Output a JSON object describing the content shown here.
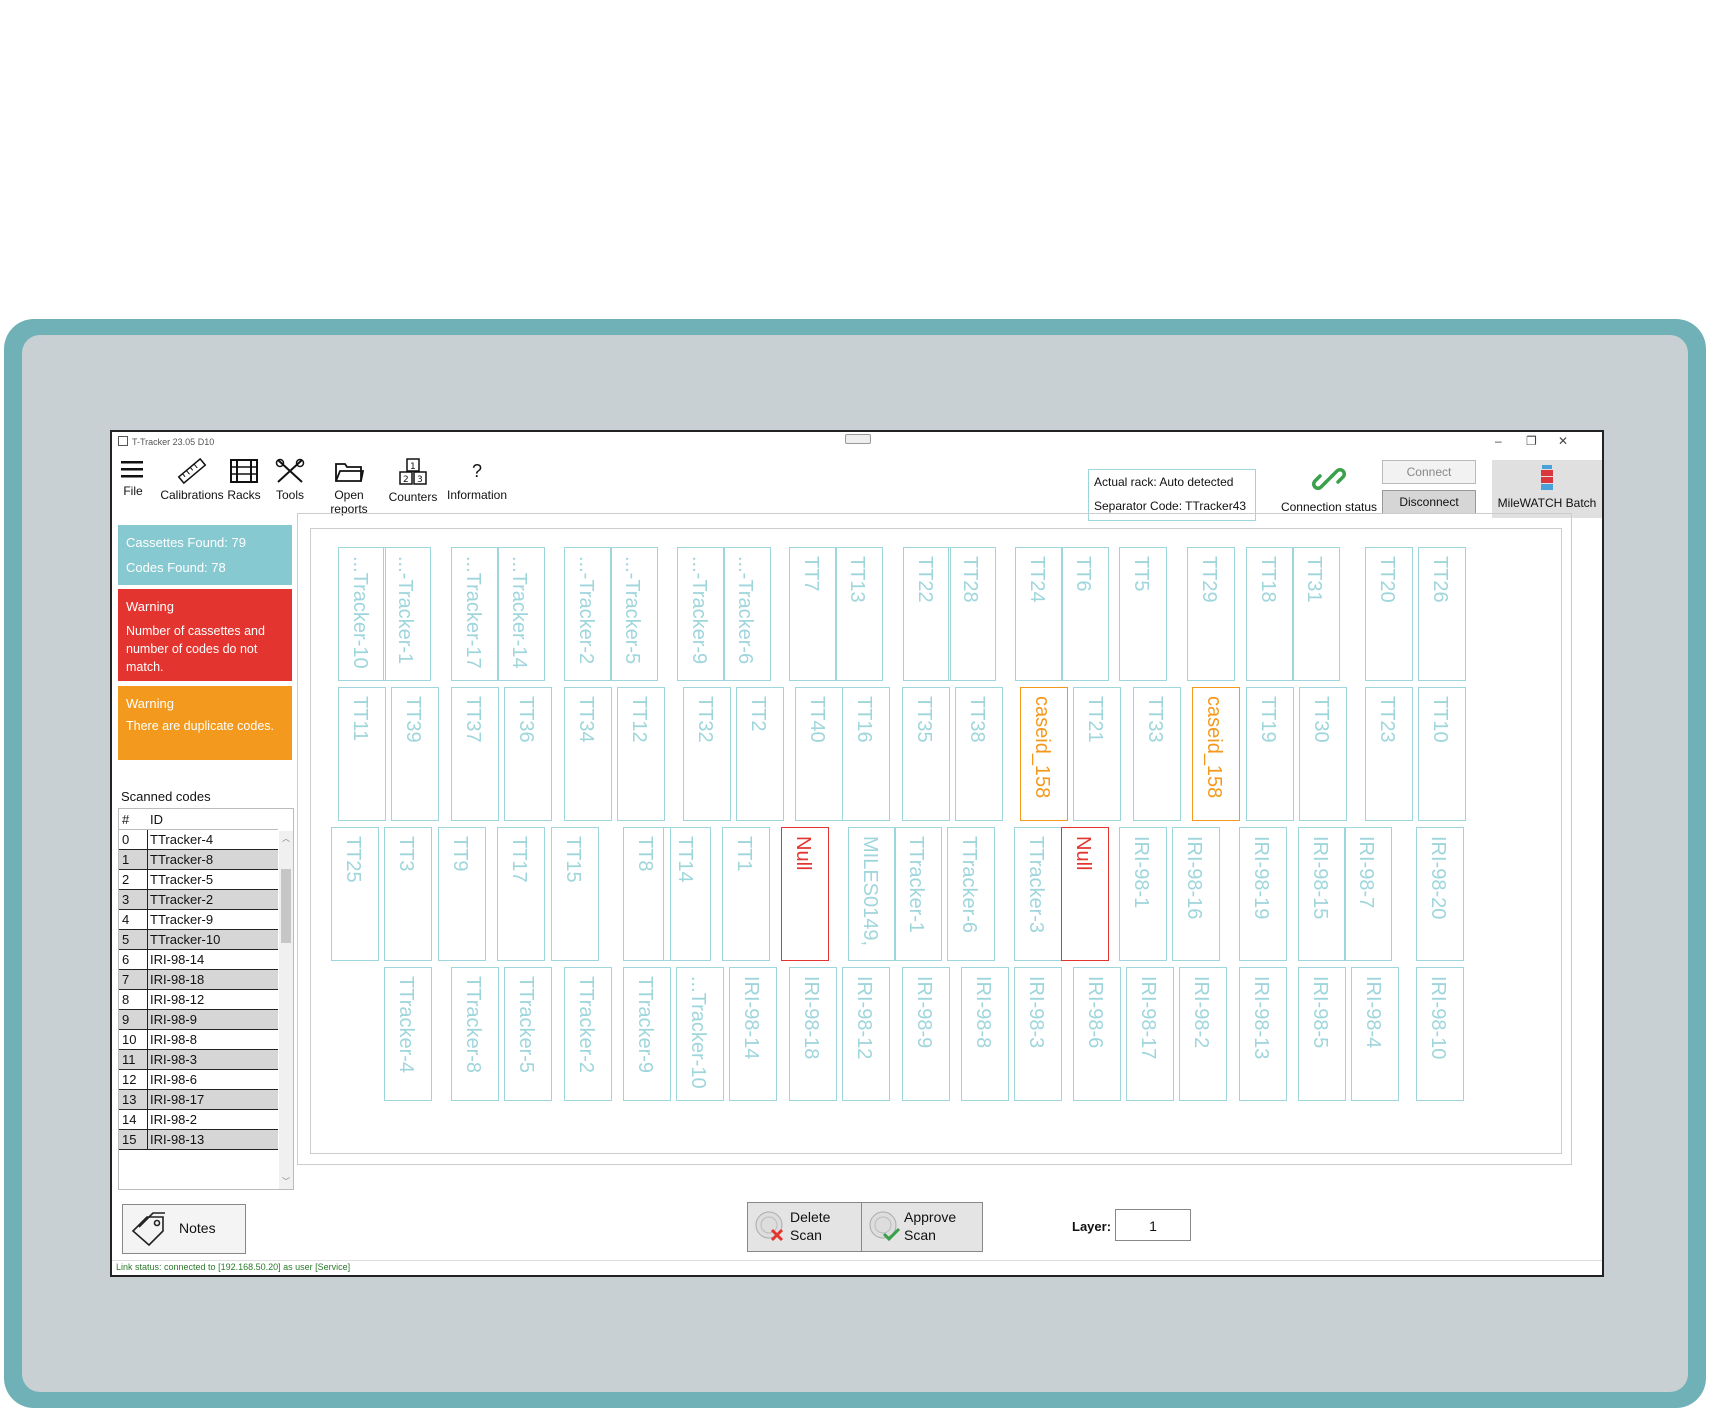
{
  "window": {
    "title": "T-Tracker 23.05 D10"
  },
  "toolbar": {
    "file": "File",
    "calibrations": "Calibrations",
    "racks": "Racks",
    "tools": "Tools",
    "open_reports": "Open reports",
    "counters": "Counters",
    "information": "Information"
  },
  "rack_info": {
    "actual_rack": "Actual rack: Auto detected",
    "separator": "Separator Code: TTracker43"
  },
  "connection": {
    "status_label": "Connection status",
    "connect": "Connect",
    "disconnect": "Disconnect",
    "batch": "MileWATCH Batch"
  },
  "summary": {
    "cassettes": "Cassettes Found:  79",
    "codes": "Codes Found:  78"
  },
  "warning1": {
    "title": "Warning",
    "text": "Number of cassettes and number of codes do not match."
  },
  "warning2": {
    "title": "Warning",
    "text": "There are duplicate codes."
  },
  "scanned": {
    "label": "Scanned codes",
    "col_idx": "#",
    "col_id": "ID",
    "rows": [
      [
        "0",
        "TTracker-4"
      ],
      [
        "1",
        "TTracker-8"
      ],
      [
        "2",
        "TTracker-5"
      ],
      [
        "3",
        "TTracker-2"
      ],
      [
        "4",
        "TTracker-9"
      ],
      [
        "5",
        "TTracker-10"
      ],
      [
        "6",
        "IRI-98-14"
      ],
      [
        "7",
        "IRI-98-18"
      ],
      [
        "8",
        "IRI-98-12"
      ],
      [
        "9",
        "IRI-98-9"
      ],
      [
        "10",
        "IRI-98-8"
      ],
      [
        "11",
        "IRI-98-3"
      ],
      [
        "12",
        "IRI-98-6"
      ],
      [
        "13",
        "IRI-98-17"
      ],
      [
        "14",
        "IRI-98-2"
      ],
      [
        "15",
        "IRI-98-13"
      ]
    ]
  },
  "rack": {
    "rows": [
      [
        [
          "...Tracker-10",
          27
        ],
        [
          "...-Tracker-1",
          72
        ],
        [
          "...Tracker-17",
          140
        ],
        [
          "...Tracker-14",
          186
        ],
        [
          "...-Tracker-2",
          253
        ],
        [
          "...-Tracker-5",
          299
        ],
        [
          "...-Tracker-9",
          366
        ],
        [
          "...-Tracker-6",
          412
        ],
        [
          "TT7",
          478
        ],
        [
          "TT13",
          524
        ],
        [
          "TT22",
          592
        ],
        [
          "TT28",
          637
        ],
        [
          "TT24",
          704
        ],
        [
          "TT6",
          750
        ],
        [
          "TT5",
          808
        ],
        [
          "TT29",
          876
        ],
        [
          "TT18",
          935
        ],
        [
          "TT31",
          981
        ],
        [
          "TT20",
          1054
        ],
        [
          "TT26",
          1107
        ]
      ],
      [
        [
          "TT11",
          27
        ],
        [
          "TT39",
          80
        ],
        [
          "TT37",
          140
        ],
        [
          "TT36",
          193
        ],
        [
          "TT34",
          253
        ],
        [
          "TT12",
          306
        ],
        [
          "TT32",
          372
        ],
        [
          "TT2",
          425
        ],
        [
          "TT40",
          484
        ],
        [
          "TT16",
          531
        ],
        [
          "TT35",
          591
        ],
        [
          "TT38",
          644
        ],
        [
          "caseid_158",
          709,
          "warn"
        ],
        [
          "TT21",
          762
        ],
        [
          "TT33",
          822
        ],
        [
          "caseid_158",
          881,
          "warn"
        ],
        [
          "TT19",
          935
        ],
        [
          "TT30",
          988
        ],
        [
          "TT23",
          1054
        ],
        [
          "TT10",
          1107
        ]
      ],
      [
        [
          "TT25",
          20
        ],
        [
          "TT3",
          73
        ],
        [
          "TT9",
          127
        ],
        [
          "TT17",
          186
        ],
        [
          "TT15",
          240
        ],
        [
          "TT8",
          312
        ],
        [
          "TT14",
          352
        ],
        [
          "TT1",
          411
        ],
        [
          "Null",
          470,
          "err"
        ],
        [
          "MILES0149,",
          537
        ],
        [
          "TTracker-1",
          583
        ],
        [
          "TTracker-6",
          636
        ],
        [
          "TTracker-3",
          703
        ],
        [
          "Null",
          750,
          "err"
        ],
        [
          "IRI-98-1",
          808
        ],
        [
          "IRI-98-16",
          861
        ],
        [
          "IRI-98-19",
          928
        ],
        [
          "IRI-98-15",
          987
        ],
        [
          "IRI-98-7",
          1033
        ],
        [
          "IRI-98-20",
          1105
        ]
      ],
      [
        [
          "TTracker-4",
          73
        ],
        [
          "TTracker-8",
          140
        ],
        [
          "TTracker-5",
          193
        ],
        [
          "TTracker-2",
          253
        ],
        [
          "TTracker-9",
          312
        ],
        [
          "...Tracker-10",
          365
        ],
        [
          "IRI-98-14",
          418
        ],
        [
          "IRI-98-18",
          478
        ],
        [
          "IRI-98-12",
          531
        ],
        [
          "IRI-98-9",
          591
        ],
        [
          "IRI-98-8",
          650
        ],
        [
          "IRI-98-3",
          703
        ],
        [
          "IRI-98-6",
          762
        ],
        [
          "IRI-98-17",
          815
        ],
        [
          "IRI-98-2",
          868
        ],
        [
          "IRI-98-13",
          928
        ],
        [
          "IRI-98-5",
          987
        ],
        [
          "IRI-98-4",
          1040
        ],
        [
          "IRI-98-10",
          1105
        ]
      ]
    ]
  },
  "bottom": {
    "notes": "Notes",
    "delete_1": "Delete",
    "delete_2": "Scan",
    "approve_1": "Approve",
    "approve_2": "Scan",
    "layer_label": "Layer:",
    "layer_value": "1"
  },
  "status": {
    "link": "Link status: connected to [192.168.50.20] as user [Service]"
  },
  "colors": {
    "bezel": "#6fb1b6",
    "panel": "#c9d0d3",
    "accent": "#9fd6dc",
    "info": "#87c9d1",
    "error": "#e3342f",
    "warning": "#f39a1e"
  }
}
